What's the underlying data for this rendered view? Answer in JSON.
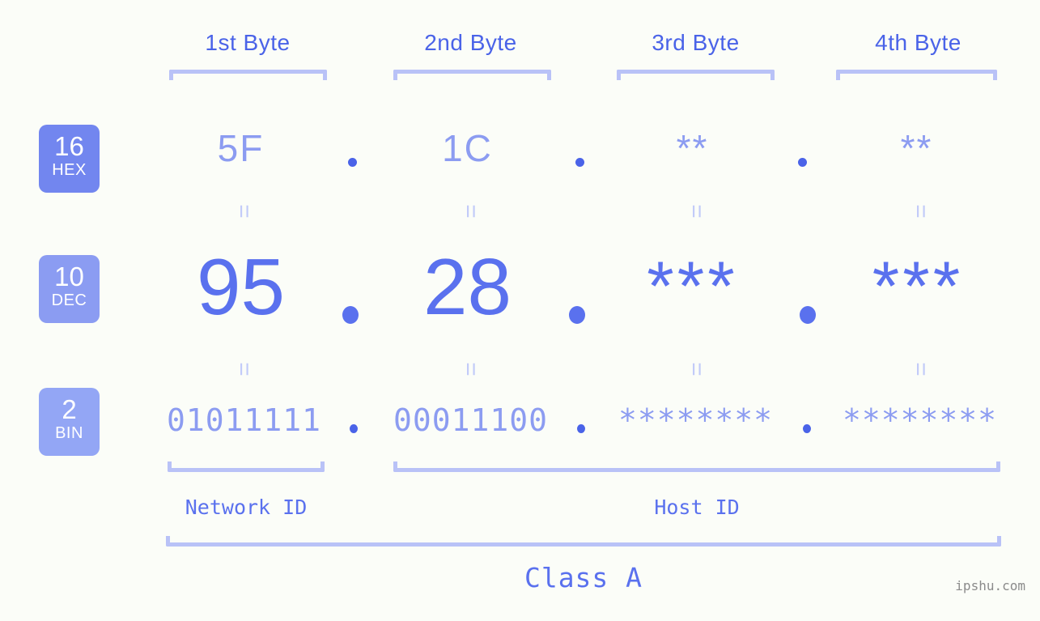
{
  "meta": {
    "background_color": "#fbfdf8",
    "accent_strong": "#4a63e8",
    "accent_mid": "#5a71ee",
    "accent_light": "#8c9cf1",
    "accent_pale": "#b9c2f7",
    "watermark_color": "#8b8b8b"
  },
  "byte_headers": [
    {
      "label": "1st Byte"
    },
    {
      "label": "2nd Byte"
    },
    {
      "label": "3rd Byte"
    },
    {
      "label": "4th Byte"
    }
  ],
  "bases": [
    {
      "number": "16",
      "name": "HEX",
      "color": "#7286ef"
    },
    {
      "number": "10",
      "name": "DEC",
      "color": "#8b9cf2"
    },
    {
      "number": "2",
      "name": "BIN",
      "color": "#93a6f5"
    }
  ],
  "rows": {
    "hex": {
      "values": [
        "5F",
        "1C",
        "**",
        "**"
      ],
      "separator": "."
    },
    "dec": {
      "values": [
        "95",
        "28",
        "***",
        "***"
      ],
      "separator": "."
    },
    "bin": {
      "values": [
        "01011111",
        "00011100",
        "********",
        "********"
      ],
      "separator": "."
    }
  },
  "equals_symbol": "=",
  "id_sections": [
    {
      "label": "Network ID"
    },
    {
      "label": "Host ID"
    }
  ],
  "class_label": "Class A",
  "watermark": "ipshu.com"
}
